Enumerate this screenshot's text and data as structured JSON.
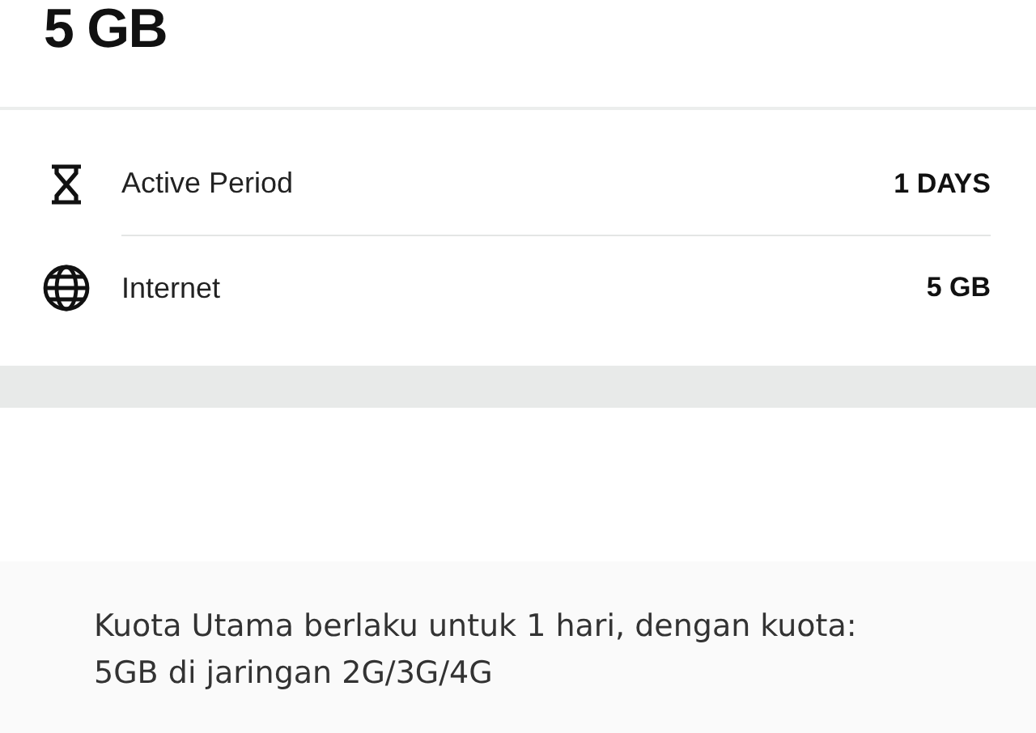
{
  "package": {
    "title": "5 GB"
  },
  "details": [
    {
      "kind": "period",
      "label": "Active Period",
      "value": "1 DAYS"
    },
    {
      "kind": "internet",
      "label": "Internet",
      "value": "5 GB"
    }
  ],
  "description": {
    "lines": [
      "Kuota Utama berlaku untuk 1 hari, dengan kuota:",
      "5GB di jaringan 2G/3G/4G"
    ]
  }
}
